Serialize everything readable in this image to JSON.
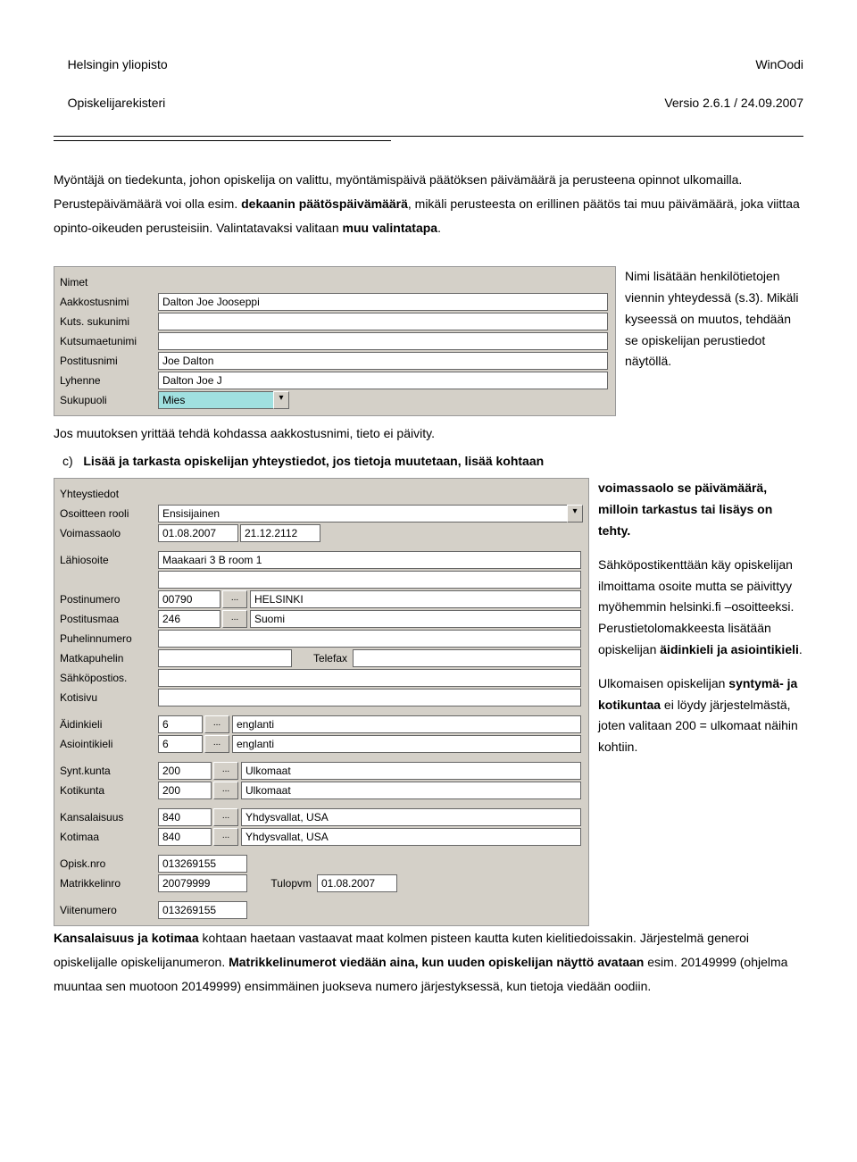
{
  "header": {
    "leftTop": "Helsingin yliopisto",
    "leftBottom": "Opiskelijarekisteri",
    "rightTop": "WinOodi",
    "rightBottom": "Versio 2.6.1 / 24.09.2007"
  },
  "intro": {
    "p1a": "Myöntäjä on tiedekunta, johon opiskelija on valittu, myöntämispäivä päätöksen päivämäärä ja perusteena opinnot ulkomailla. Perustepäivämäärä voi olla esim. ",
    "p1b": "dekaanin päätöspäivämäärä",
    "p1c": ", mikäli perusteesta on erillinen päätös tai muu päivämäärä, joka viittaa opinto-oikeuden perusteisiin. Valintatavaksi valitaan ",
    "p1d": "muu valintatapa",
    "p1e": "."
  },
  "namesForm": {
    "labels": {
      "nimet": "Nimet",
      "aakkostusnimi": "Aakkostusnimi",
      "kuts_sukunimi": "Kuts. sukunimi",
      "kutsumaetunimi": "Kutsumaetunimi",
      "postitusnimi": "Postitusnimi",
      "lyhenne": "Lyhenne",
      "sukupuoli": "Sukupuoli"
    },
    "values": {
      "aakkostusnimi": "Dalton Joe Jooseppi",
      "kuts_sukunimi": "",
      "kutsumaetunimi": "",
      "postitusnimi": "Joe Dalton",
      "lyhenne": "Dalton Joe J",
      "sukupuoli": "Mies"
    }
  },
  "side1": "Nimi lisätään henkilötietojen viennin yhteydessä (s.3). Mikäli kyseessä on muutos, tehdään se opiskelijan perustiedot näytöllä.",
  "afterNames": {
    "line1": "Jos muutoksen yrittää tehdä kohdassa aakkostusnimi, tieto ei päivity.",
    "cLabel": "c)",
    "cBold": "Lisää ja tarkasta opiskelijan yhteystiedot, jos tietoja muutetaan, lisää kohtaan"
  },
  "contactForm": {
    "labels": {
      "yhteystiedot": "Yhteystiedot",
      "osoitteenRooli": "Osoitteen rooli",
      "voimassaolo": "Voimassaolo",
      "lahiosoite": "Lähiosoite",
      "postinumero": "Postinumero",
      "postitusmaa": "Postitusmaa",
      "puhelinnumero": "Puhelinnumero",
      "matkapuhelin": "Matkapuhelin",
      "telefax": "Telefax",
      "sahkopostios": "Sähköpostios.",
      "kotisivu": "Kotisivu",
      "aidinkieli": "Äidinkieli",
      "asiointikieli": "Asiointikieli",
      "syntkunta": "Synt.kunta",
      "kotikunta": "Kotikunta",
      "kansalaisuus": "Kansalaisuus",
      "kotimaa": "Kotimaa",
      "opisknro": "Opisk.nro",
      "matrikkelinro": "Matrikkelinro",
      "tulopvm": "Tulopvm",
      "viitenumero": "Viitenumero"
    },
    "values": {
      "osoitteenRooli": "Ensisijainen",
      "voim1": "01.08.2007",
      "voim2": "21.12.2112",
      "lahiosoite": "Maakaari 3 B room 1",
      "postinumero": "00790",
      "postinumeroCity": "HELSINKI",
      "postitusmaa": "246",
      "postitusmaaName": "Suomi",
      "aidinkieli": "6",
      "aidinkieliName": "englanti",
      "asiointikieli": "6",
      "asiointikieliName": "englanti",
      "syntkunta": "200",
      "syntkuntaName": "Ulkomaat",
      "kotikunta": "200",
      "kotikuntaName": "Ulkomaat",
      "kansalaisuus": "840",
      "kansalaisuusName": "Yhdysvallat, USA",
      "kotimaa": "840",
      "kotimaaName": "Yhdysvallat, USA",
      "opisknro": "013269155",
      "matrikkelinro": "20079999",
      "tulopvm": "01.08.2007",
      "viitenumero": "013269155"
    }
  },
  "side2": {
    "p1a": "voimassaolo se päivämäärä, milloin tarkastus tai lisäys on tehty.",
    "p2a": "Sähköpostikenttään käy opiskelijan ilmoittama osoite mutta se päivittyy myöhemmin helsinki.fi –osoitteeksi. Perustietolomakkeesta lisätään opiskelijan ",
    "p2b": "äidinkieli ja asiointikieli",
    "p2c": ".",
    "p3a": "Ulkomaisen opiskelijan ",
    "p3b": "syntymä- ja kotikuntaa",
    "p3c": " ei löydy järjestelmästä, joten valitaan 200 = ulkomaat näihin kohtiin."
  },
  "bottom": {
    "b1a": "Kansalaisuus ja kotimaa",
    "b1b": " kohtaan haetaan vastaavat maat kolmen pisteen kautta kuten kielitiedoissakin. Järjestelmä generoi opiskelijalle opiskelijanumeron. ",
    "b1c": "Matrikkelinumerot viedään aina, kun uuden opiskelijan näyttö avataan",
    "b1d": " esim. 20149999 (ohjelma muuntaa sen muotoon 20149999) ensimmäinen juokseva numero järjestyksessä, kun tietoja viedään oodiin."
  },
  "icons": {
    "ellipsis": "...",
    "dropdown": "▾"
  }
}
